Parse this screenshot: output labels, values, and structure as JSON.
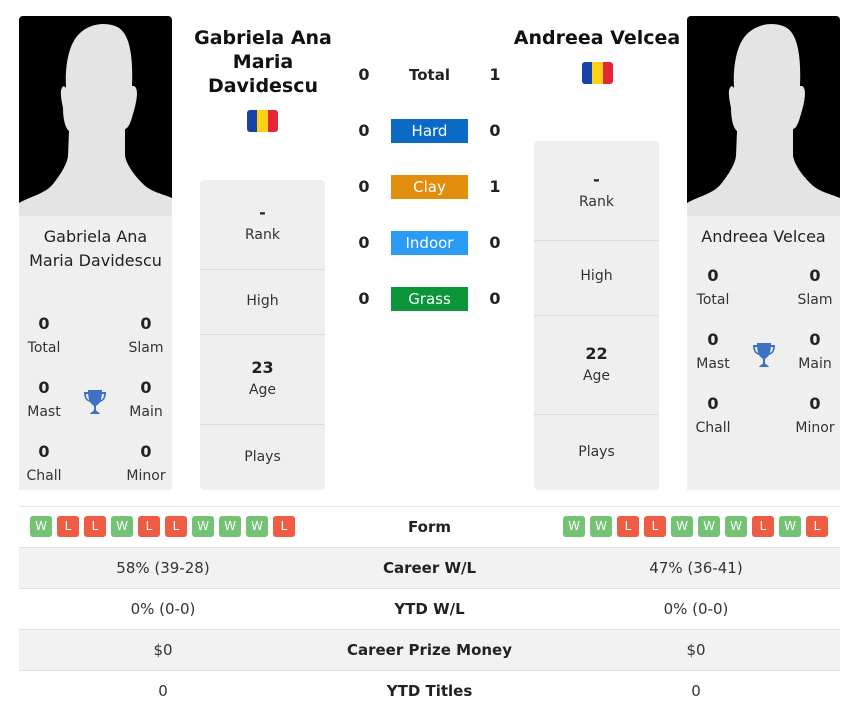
{
  "colors": {
    "hard": "#0b6bc4",
    "clay": "#e08e0b",
    "indoor": "#2a9bf5",
    "grass": "#0a9639",
    "win": "#74c374",
    "loss": "#ee5d43",
    "trophy": "#3d72c2",
    "flag_blue": "#1743a8",
    "flag_yellow": "#fcd116",
    "flag_red": "#e62638"
  },
  "player_left": {
    "header_name": "Gabriela Ana Maria Davidescu",
    "card_name": "Gabriela Ana Maria Davidescu",
    "flag_icon": "romania-flag-icon",
    "titles": {
      "total": {
        "value": "0",
        "label": "Total"
      },
      "slam": {
        "value": "0",
        "label": "Slam"
      },
      "mast": {
        "value": "0",
        "label": "Mast"
      },
      "main": {
        "value": "0",
        "label": "Main"
      },
      "chall": {
        "value": "0",
        "label": "Chall"
      },
      "minor": {
        "value": "0",
        "label": "Minor"
      }
    },
    "info": {
      "rank": {
        "value": "-",
        "label": "Rank"
      },
      "high": {
        "value": "",
        "label": "High"
      },
      "age": {
        "value": "23",
        "label": "Age"
      },
      "plays": {
        "value": "",
        "label": "Plays"
      }
    },
    "form": [
      "W",
      "L",
      "L",
      "W",
      "L",
      "L",
      "W",
      "W",
      "W",
      "L"
    ],
    "career_wl": "58% (39-28)",
    "ytd_wl": "0% (0-0)",
    "prize": "$0",
    "ytd_titles": "0"
  },
  "player_right": {
    "header_name": "Andreea Velcea",
    "card_name": "Andreea Velcea",
    "flag_icon": "romania-flag-icon",
    "titles": {
      "total": {
        "value": "0",
        "label": "Total"
      },
      "slam": {
        "value": "0",
        "label": "Slam"
      },
      "mast": {
        "value": "0",
        "label": "Mast"
      },
      "main": {
        "value": "0",
        "label": "Main"
      },
      "chall": {
        "value": "0",
        "label": "Chall"
      },
      "minor": {
        "value": "0",
        "label": "Minor"
      }
    },
    "info": {
      "rank": {
        "value": "-",
        "label": "Rank"
      },
      "high": {
        "value": "",
        "label": "High"
      },
      "age": {
        "value": "22",
        "label": "Age"
      },
      "plays": {
        "value": "",
        "label": "Plays"
      }
    },
    "form": [
      "W",
      "W",
      "L",
      "L",
      "W",
      "W",
      "W",
      "L",
      "W",
      "L"
    ],
    "career_wl": "47% (36-41)",
    "ytd_wl": "0% (0-0)",
    "prize": "$0",
    "ytd_titles": "0"
  },
  "h2h": [
    {
      "label": "Total",
      "left": "0",
      "right": "1",
      "surface": "total"
    },
    {
      "label": "Hard",
      "left": "0",
      "right": "0",
      "surface": "hard"
    },
    {
      "label": "Clay",
      "left": "0",
      "right": "1",
      "surface": "clay"
    },
    {
      "label": "Indoor",
      "left": "0",
      "right": "0",
      "surface": "indoor"
    },
    {
      "label": "Grass",
      "left": "0",
      "right": "0",
      "surface": "grass"
    }
  ],
  "comparison": {
    "form_label": "Form",
    "career_wl_label": "Career W/L",
    "ytd_wl_label": "YTD W/L",
    "prize_label": "Career Prize Money",
    "ytd_titles_label": "YTD Titles"
  }
}
